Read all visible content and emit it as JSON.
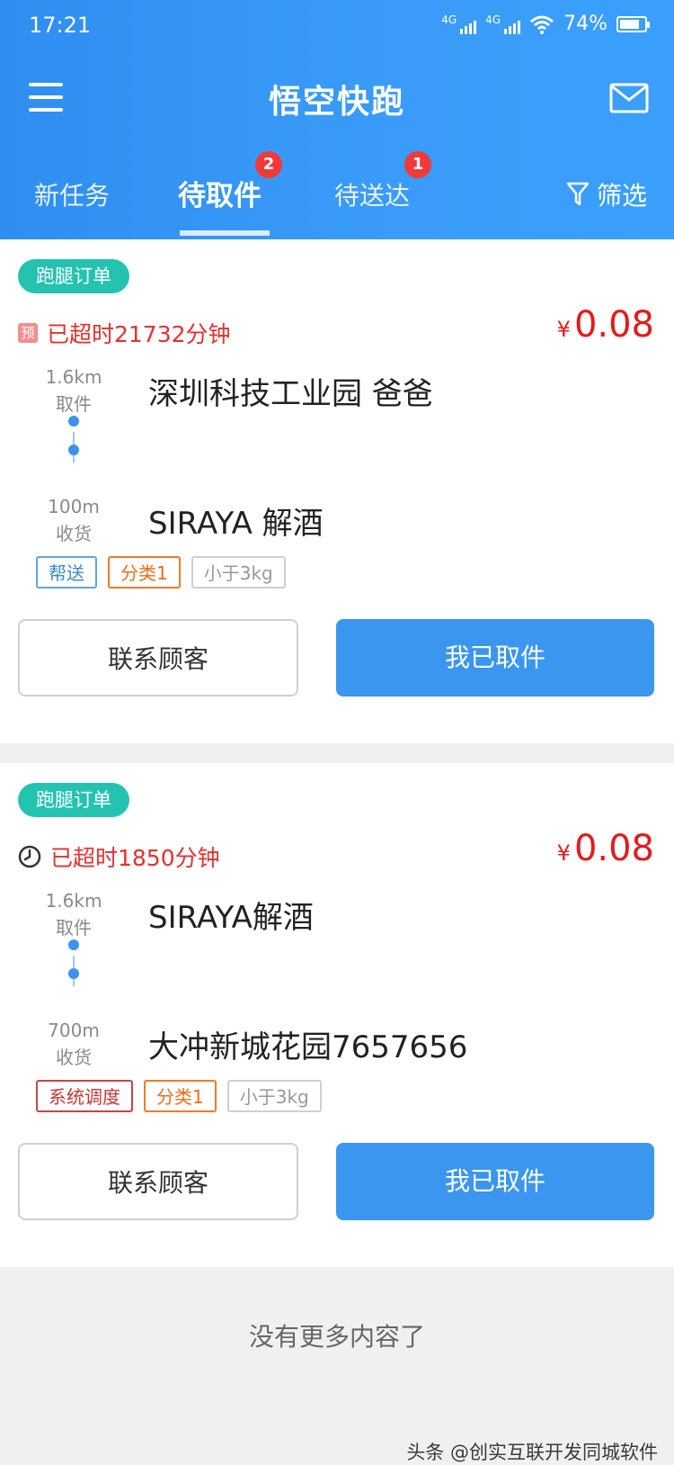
{
  "status_bar": {
    "time": "17:21",
    "net1": "4G",
    "net2": "4G",
    "battery": "74%"
  },
  "header": {
    "title": "悟空快跑"
  },
  "tabs": [
    {
      "label": "新任务"
    },
    {
      "label": "待取件",
      "badge": "2"
    },
    {
      "label": "待送达",
      "badge": "1"
    }
  ],
  "filter_label": "筛选",
  "orders": [
    {
      "type": "跑腿订单",
      "prefix": "预",
      "overtime": "已超时21732分钟",
      "currency": "¥",
      "price": "0.08",
      "pickup_distance": "1.6km",
      "pickup_label": "取件",
      "delivery_distance": "100m",
      "delivery_label": "收货",
      "pickup_address": "深圳科技工业园 爸爸",
      "delivery_address": "SIRAYA 解酒",
      "tags": [
        "帮送",
        "分类1",
        "小于3kg"
      ],
      "contact_button": "联系顾客",
      "action_button": "我已取件"
    },
    {
      "type": "跑腿订单",
      "overtime": "已超时1850分钟",
      "currency": "¥",
      "price": "0.08",
      "pickup_distance": "1.6km",
      "pickup_label": "取件",
      "delivery_distance": "700m",
      "delivery_label": "收货",
      "pickup_address": "SIRAYA解酒",
      "delivery_address": "大冲新城花园7657656",
      "tags": [
        "系统调度",
        "分类1",
        "小于3kg"
      ],
      "contact_button": "联系顾客",
      "action_button": "我已取件"
    }
  ],
  "footer_text": "没有更多内容了",
  "watermark": "头条 @创实互联开发同城软件"
}
